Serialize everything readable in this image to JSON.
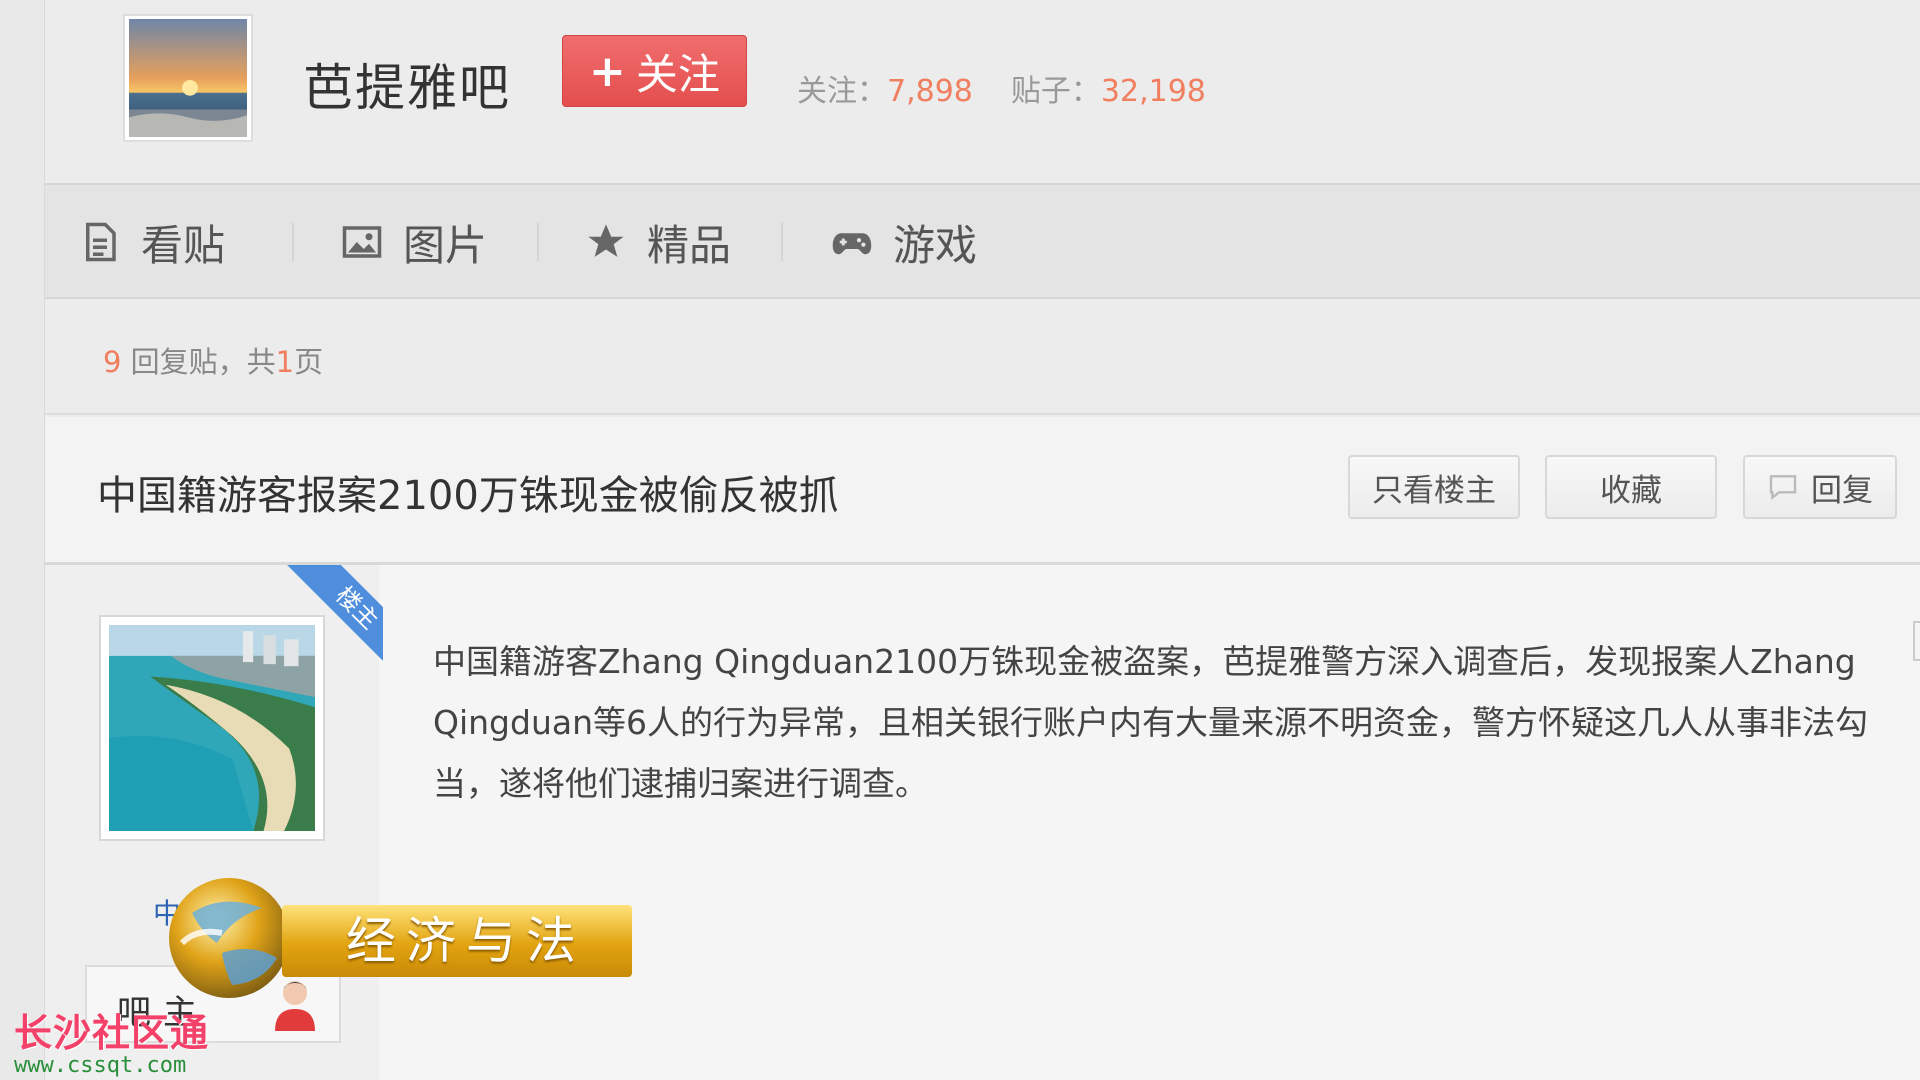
{
  "forum": {
    "name": "芭提雅吧",
    "follow_label": "关注",
    "stats": {
      "follow_label": "关注：",
      "follow_count": "7,898",
      "posts_label": "贴子：",
      "posts_count": "32,198"
    }
  },
  "nav": {
    "items": [
      {
        "label": "看贴",
        "icon": "document-icon"
      },
      {
        "label": "图片",
        "icon": "image-icon"
      },
      {
        "label": "精品",
        "icon": "star-icon"
      },
      {
        "label": "游戏",
        "icon": "gamepad-icon"
      }
    ]
  },
  "thread": {
    "reply_count": "9",
    "reply_text": " 回复贴，共",
    "page_count": "1",
    "page_suffix": "页",
    "title": "中国籍游客报案2100万铢现金被偷反被抓",
    "actions": {
      "only_owner": "只看楼主",
      "favorite": "收藏",
      "reply": "回复"
    }
  },
  "post": {
    "owner_badge": "楼主",
    "author_name": "中",
    "role": "吧主",
    "content": "中国籍游客Zhang Qingduan2100万铢现金被盗案，芭提雅警方深入调查后，发现报案人Zhang Qingduan等6人的行为异常，且相关银行账户内有大量来源不明资金，警方怀疑这几人从事非法勾当，遂将他们逮捕归案进行调查。"
  },
  "overlay": {
    "tv_program": "经济与法",
    "watermark_name": "长沙社区通",
    "watermark_url": "www.cssqt.com"
  },
  "colors": {
    "follow_button": "#e44e4e",
    "stat_number": "#f07f5f",
    "owner_badge": "#4f8edc",
    "author_link": "#2d64b3"
  }
}
